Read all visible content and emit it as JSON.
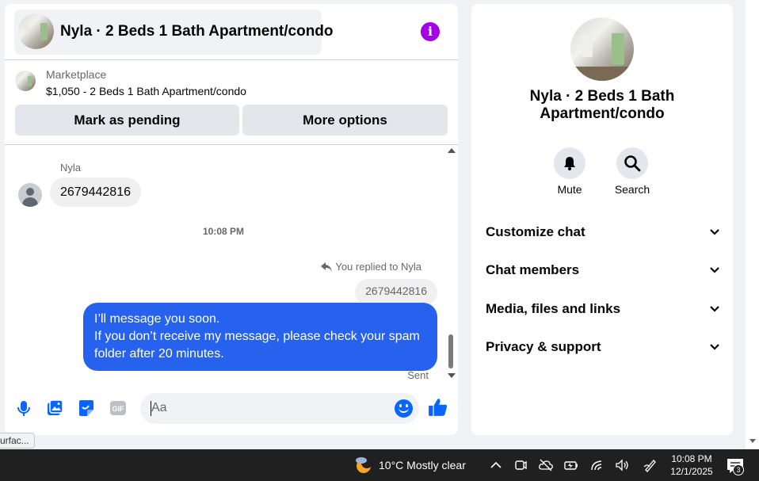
{
  "chat": {
    "title": "Nyla · 2 Beds 1 Bath Apartment/condo",
    "marketplace_label": "Marketplace",
    "listing": "$1,050 - 2 Beds 1 Bath Apartment/condo",
    "mark_pending_label": "Mark as pending",
    "more_options_label": "More options",
    "messages": {
      "incoming_sender": "Nyla",
      "incoming_text": "2679442816",
      "time_divider": "10:08 PM",
      "replied_to": "You replied to Nyla",
      "quoted_text": "2679442816",
      "outgoing_line1": "I’ll message you soon.",
      "outgoing_line2": "If you don’t receive my message, please check your spam folder after 20 minutes.",
      "status": "Sent"
    },
    "composer": {
      "placeholder": "Aa"
    }
  },
  "info_panel": {
    "title": "Nyla · 2 Beds 1 Bath Apartment/condo",
    "actions": [
      {
        "label": "Mute",
        "icon": "bell-icon"
      },
      {
        "label": "Search",
        "icon": "search-icon"
      }
    ],
    "sections": [
      {
        "label": "Customize chat"
      },
      {
        "label": "Chat members"
      },
      {
        "label": "Media, files and links"
      },
      {
        "label": "Privacy & support"
      }
    ]
  },
  "status_tip": "urfac...",
  "taskbar": {
    "weather": "10°C  Mostly clear",
    "time": "10:08 PM",
    "date": "12/1/2025",
    "notification_count": "3"
  },
  "colors": {
    "accent": "#0866ff",
    "outgoing_bubble": "#2762ee",
    "info_icon": "#a200e6"
  }
}
